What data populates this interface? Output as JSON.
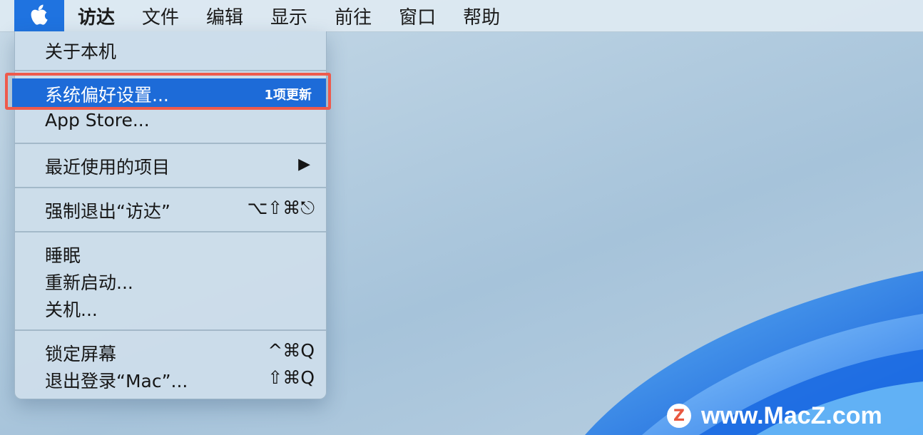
{
  "menubar": {
    "apple_icon": "apple-logo-icon",
    "items": [
      {
        "label": "访达",
        "bold": true
      },
      {
        "label": "文件"
      },
      {
        "label": "编辑"
      },
      {
        "label": "显示"
      },
      {
        "label": "前往"
      },
      {
        "label": "窗口"
      },
      {
        "label": "帮助"
      }
    ]
  },
  "apple_menu": {
    "about": "关于本机",
    "system_prefs": "系统偏好设置...",
    "system_prefs_badge": "1项更新",
    "app_store": "App Store...",
    "recent_items": "最近使用的项目",
    "recent_items_arrow": "▶",
    "force_quit": "强制退出“访达”",
    "force_quit_shortcut": "⌥⇧⌘⎋",
    "sleep": "睡眠",
    "restart": "重新启动...",
    "shutdown": "关机...",
    "lock_screen": "锁定屏幕",
    "lock_screen_shortcut": "^⌘Q",
    "logout": "退出登录“Mac”...",
    "logout_shortcut": "⇧⌘Q"
  },
  "watermark": {
    "logo": "Z",
    "text": "www.MacZ.com"
  },
  "colors": {
    "highlight": "#1d6bd8",
    "annotation_box": "#ee5a4c"
  }
}
